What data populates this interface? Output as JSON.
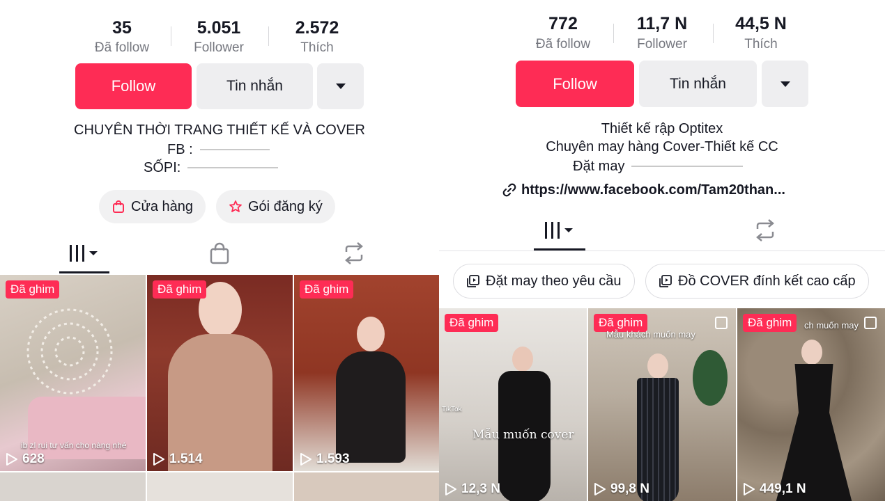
{
  "left": {
    "stats": [
      {
        "value": "35",
        "label": "Đã follow"
      },
      {
        "value": "5.051",
        "label": "Follower"
      },
      {
        "value": "2.572",
        "label": "Thích"
      }
    ],
    "follow_label": "Follow",
    "message_label": "Tin nhắn",
    "bio_lines": [
      "CHUYÊN THỜI TRANG THIẾT KẾ VÀ COVER",
      "FB :",
      "SỐPI:"
    ],
    "chips": [
      {
        "label": "Cửa hàng",
        "icon": "shopping-bag-icon"
      },
      {
        "label": "Gói đăng ký",
        "icon": "star-badge-icon"
      }
    ],
    "videos": [
      {
        "badge": "Đã ghim",
        "views": "628",
        "caption": "ib zl rui tư vấn cho nàng nhé"
      },
      {
        "badge": "Đã ghim",
        "views": "1.514"
      },
      {
        "badge": "Đã ghim",
        "views": "1.593"
      }
    ]
  },
  "right": {
    "stats": [
      {
        "value": "772",
        "label": "Đã follow"
      },
      {
        "value": "11,7 N",
        "label": "Follower"
      },
      {
        "value": "44,5 N",
        "label": "Thích"
      }
    ],
    "follow_label": "Follow",
    "message_label": "Tin nhắn",
    "bio_lines": [
      "Thiết kế rập Optitex",
      "Chuyên may hàng Cover-Thiết kế CC",
      "Đặt may"
    ],
    "link": "https://www.facebook.com/Tam20than...",
    "playlists": [
      {
        "label": "Đặt may theo yêu cầu",
        "icon": "playlist-icon"
      },
      {
        "label": "Đồ COVER đính kết cao cấp",
        "icon": "playlist-icon"
      }
    ],
    "videos": [
      {
        "badge": "Đã ghim",
        "views": "12,3 N",
        "caption": "Mẫu muốn cover",
        "watermark": "TikTok"
      },
      {
        "badge": "Đã ghim",
        "views": "99,8 N",
        "caption": "Mẫu khách muốn may"
      },
      {
        "badge": "Đã ghim",
        "views": "449,1 N",
        "caption": "ch muốn may"
      }
    ]
  },
  "colors": {
    "accent": "#fe2c55",
    "button_gray": "#eeeef0",
    "text": "#161823",
    "muted": "#75777f"
  }
}
